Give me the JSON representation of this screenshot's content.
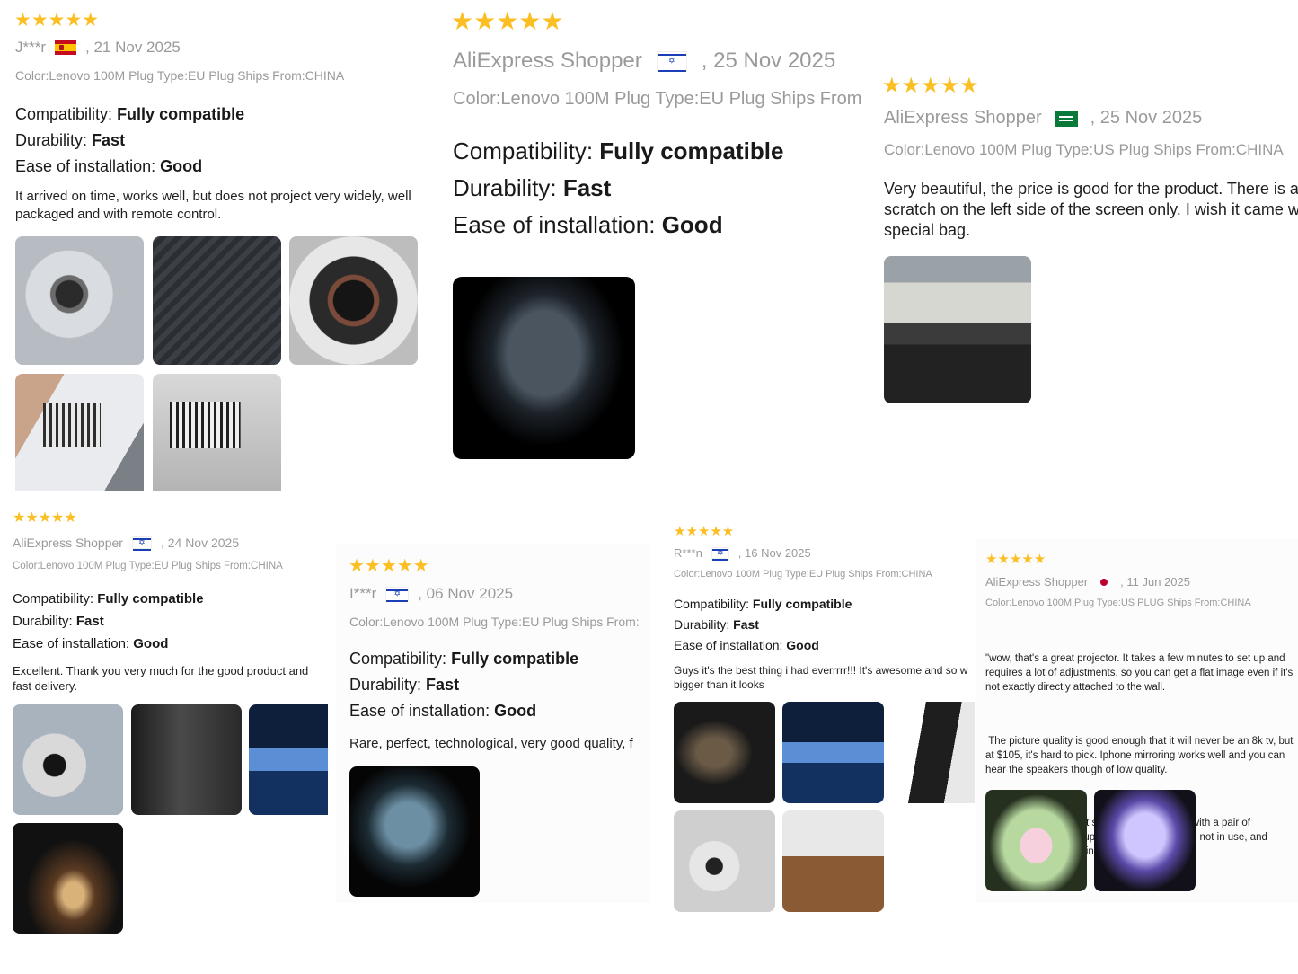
{
  "reviews": [
    {
      "stars": "★★★★★",
      "author": "J***r",
      "date": ", 21 Nov 2025",
      "sku": "Color:Lenovo 100M Plug Type:EU Plug Ships From:CHINA",
      "attrs": [
        {
          "label": "Compatibility:",
          "value": "Fully compatible"
        },
        {
          "label": "Durability:",
          "value": "Fast"
        },
        {
          "label": "Ease of installation:",
          "value": "Good"
        }
      ],
      "body": [
        "It arrived on time, works well, but does not project very widely, well packaged and with remote control."
      ]
    },
    {
      "stars": "★★★★★",
      "author": "AliExpress Shopper",
      "date": ", 25 Nov 2025",
      "sku": "Color:Lenovo 100M Plug Type:EU Plug Ships From",
      "attrs": [
        {
          "label": "Compatibility:",
          "value": "Fully compatible"
        },
        {
          "label": "Durability:",
          "value": "Fast"
        },
        {
          "label": "Ease of installation:",
          "value": "Good"
        }
      ],
      "body": []
    },
    {
      "stars": "★★★★★",
      "author": "AliExpress Shopper",
      "date": ", 25 Nov 2025",
      "sku": "Color:Lenovo 100M Plug Type:US Plug Ships From:CHINA",
      "attrs": [],
      "body": [
        "Very beautiful, the price is good for the product. There is a scratch on the left side of the screen only. I wish it came wi special bag."
      ]
    },
    {
      "stars": "★★★★★",
      "author": "AliExpress Shopper",
      "date": ", 24 Nov 2025",
      "sku": "Color:Lenovo 100M Plug Type:EU Plug Ships From:CHINA",
      "attrs": [
        {
          "label": "Compatibility:",
          "value": "Fully compatible"
        },
        {
          "label": "Durability:",
          "value": "Fast"
        },
        {
          "label": "Ease of installation:",
          "value": "Good"
        }
      ],
      "body": [
        "Excellent. Thank you very much for the good product and fast delivery."
      ]
    },
    {
      "stars": "★★★★★",
      "author": "I***r",
      "date": ", 06 Nov 2025",
      "sku": "Color:Lenovo 100M Plug Type:EU Plug Ships From:",
      "attrs": [
        {
          "label": "Compatibility:",
          "value": "Fully compatible"
        },
        {
          "label": "Durability:",
          "value": "Fast"
        },
        {
          "label": "Ease of installation:",
          "value": "Good"
        }
      ],
      "body": [
        "Rare, perfect, technological, very good quality, f"
      ]
    },
    {
      "stars": "★★★★★",
      "author": "R***n",
      "date": ", 16 Nov 2025",
      "sku": "Color:Lenovo 100M Plug Type:EU Plug Ships From:CHINA",
      "attrs": [
        {
          "label": "Compatibility:",
          "value": "Fully compatible"
        },
        {
          "label": "Durability:",
          "value": "Fast"
        },
        {
          "label": "Ease of installation:",
          "value": "Good"
        }
      ],
      "body": [
        "Guys it's the best thing i had everrrrr!!! It's awesome and so w bigger than it looks"
      ]
    },
    {
      "stars": "★★★★★",
      "author": "AliExpress Shopper",
      "date": ", 11 Jun 2025",
      "sku": "Color:Lenovo 100M Plug Type:US PLUG Ships From:CHINA",
      "attrs": [],
      "body": [
        "\"wow, that's a great projector. It takes a few minutes to set up and requires a lot of adjustments, so you can get a flat image even if it's not exactly directly attached to the wall.",
        " The picture quality is good enough that it will never be an 8k tv, but at $105, it's hard to pick. Iphone mirroring works well and you can hear the speakers though of low quality.",
        " I've found it to be best set up to play movies with a pair of headphones, it takes up very little space when not in use, and provides a larger viewing area when in use."
      ]
    }
  ],
  "colors": {
    "star": "#fbbf24",
    "meta": "#9a9a9a",
    "text": "#191919"
  }
}
